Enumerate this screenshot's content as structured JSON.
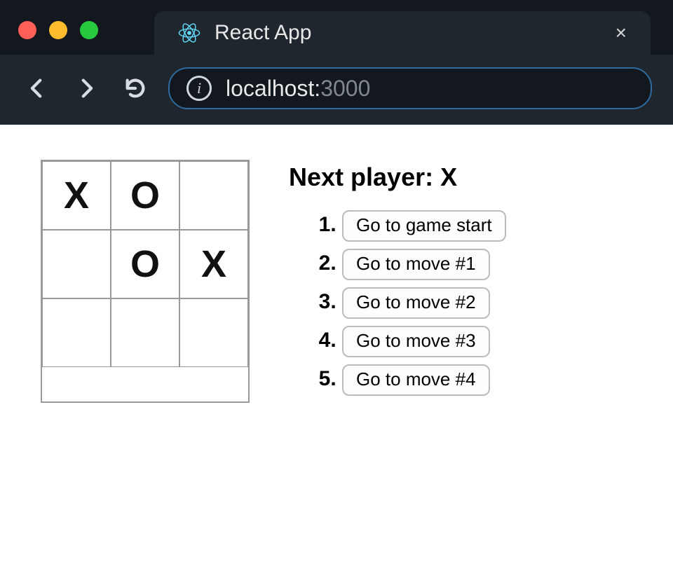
{
  "browser": {
    "tab_title": "React App",
    "url_host": "localhost:",
    "url_port": "3000"
  },
  "game": {
    "status": "Next player: X",
    "board": [
      "X",
      "O",
      "",
      "",
      "O",
      "X",
      "",
      "",
      ""
    ],
    "moves": [
      "Go to game start",
      "Go to move #1",
      "Go to move #2",
      "Go to move #3",
      "Go to move #4"
    ]
  }
}
